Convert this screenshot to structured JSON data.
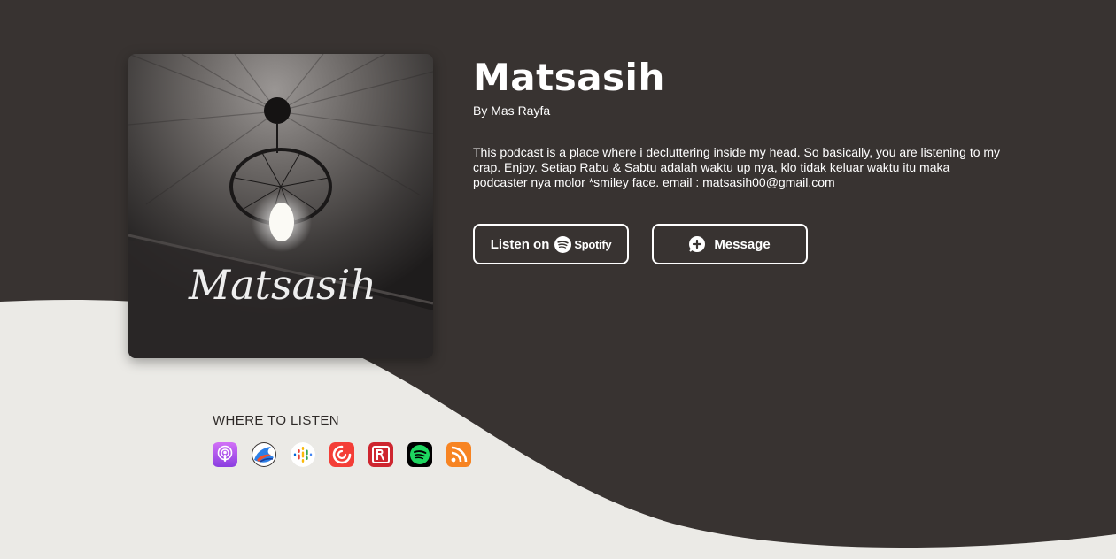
{
  "podcast": {
    "title": "Matsasih",
    "author": "By Mas Rayfa",
    "description": "This podcast is a place where i decluttering inside my head. So basically, you are listening to my crap. Enjoy. Setiap Rabu & Sabtu adalah waktu up nya, klo tidak keluar waktu itu maka podcaster nya molor *smiley face. email : matsasih00@gmail.com",
    "cover_text": "Matsasih"
  },
  "actions": {
    "listen_on_label": "Listen on",
    "spotify_wordmark": "Spotify",
    "message_label": "Message"
  },
  "where_to_listen": {
    "heading": "WHERE TO LISTEN",
    "platforms": [
      {
        "name": "Apple Podcasts",
        "icon": "apple-podcasts-icon",
        "color": "#a857e8"
      },
      {
        "name": "Castbox",
        "icon": "castbox-icon",
        "color": "#2c7fe6"
      },
      {
        "name": "Google Podcasts",
        "icon": "google-podcasts-icon",
        "color": "#ffffff"
      },
      {
        "name": "Pocket Casts",
        "icon": "pocket-casts-icon",
        "color": "#f43e37"
      },
      {
        "name": "RadioPublic",
        "icon": "radiopublic-icon",
        "color": "#ce262f"
      },
      {
        "name": "Spotify",
        "icon": "spotify-icon",
        "color": "#1db954"
      },
      {
        "name": "RSS",
        "icon": "rss-icon",
        "color": "#f78422"
      }
    ]
  },
  "colors": {
    "dark_bg": "#383331",
    "light_bg": "#ebeae6",
    "text_light": "#ffffff",
    "text_dark": "#2e2a28"
  }
}
